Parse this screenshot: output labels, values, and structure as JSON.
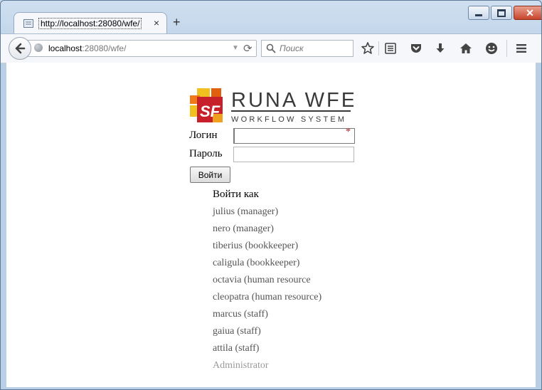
{
  "window": {
    "controls": {
      "minimize": "minimize",
      "maximize": "maximize",
      "close": "close"
    }
  },
  "tab": {
    "title": "http://localhost:28080/wfe/",
    "close_glyph": "×",
    "new_tab_glyph": "+"
  },
  "toolbar": {
    "url_host": "localhost",
    "url_path": ":28080/wfe/",
    "search_placeholder": "Поиск",
    "icons": [
      "back-icon",
      "globe-icon",
      "dropdown-icon",
      "reload-icon",
      "search-icon",
      "bookmark-star-icon",
      "reading-list-icon",
      "pocket-icon",
      "download-icon",
      "home-icon",
      "smiley-icon",
      "menu-icon"
    ]
  },
  "logo": {
    "brand": "RUNA WFE",
    "tagline": "WORKFLOW SYSTEM",
    "mark_text": "SF"
  },
  "form": {
    "login_label": "Логин",
    "password_label": "Пароль",
    "login_value": "",
    "password_value": "",
    "required_mark": "*",
    "submit_label": "Войти"
  },
  "login_as": {
    "title": "Войти как",
    "users": [
      "julius (manager)",
      "nero (manager)",
      "tiberius (bookkeeper)",
      "caligula (bookkeeper)",
      "octavia (human resource",
      "cleopatra (human resource)",
      "marcus (staff)",
      "gaiua (staff)",
      "attila (staff)",
      "Administrator"
    ]
  },
  "colors": {
    "accent_red": "#c8202a",
    "link_gray": "#555555",
    "muted_gray": "#9a9a9a"
  }
}
